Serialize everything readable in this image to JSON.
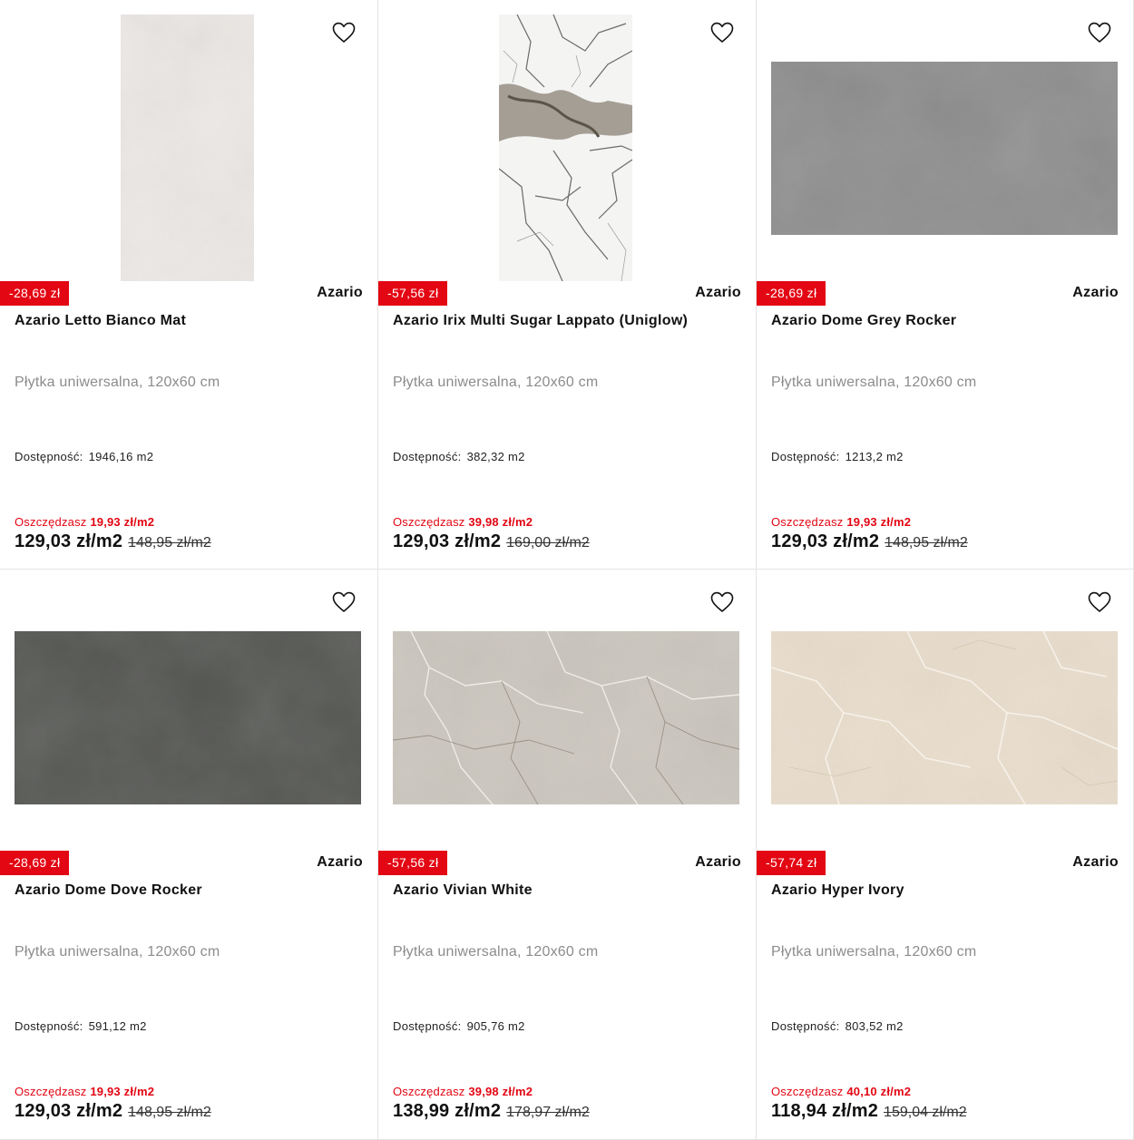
{
  "colors": {
    "accent": "#e30613",
    "text": "#111111",
    "muted": "#8c8c8c"
  },
  "products": [
    {
      "discount": "-28,69 zł",
      "brand": "Azario",
      "name": "Azario Letto Bianco Mat",
      "description": "Płytka uniwersalna, 120x60 cm",
      "availability_label": "Dostępność:",
      "availability_value": "1946,16 m2",
      "saving_label": "Oszczędzasz",
      "saving_value": "19,93 zł/m2",
      "price": "129,03 zł/m2",
      "old_price": "148,95 zł/m2",
      "favorite_icon": "heart-outline-icon"
    },
    {
      "discount": "-57,56 zł",
      "brand": "Azario",
      "name": "Azario Irix Multi Sugar Lappato (Uniglow)",
      "description": "Płytka uniwersalna, 120x60 cm",
      "availability_label": "Dostępność:",
      "availability_value": "382,32 m2",
      "saving_label": "Oszczędzasz",
      "saving_value": "39,98 zł/m2",
      "price": "129,03 zł/m2",
      "old_price": "169,00 zł/m2",
      "favorite_icon": "heart-outline-icon"
    },
    {
      "discount": "-28,69 zł",
      "brand": "Azario",
      "name": "Azario Dome Grey Rocker",
      "description": "Płytka uniwersalna, 120x60 cm",
      "availability_label": "Dostępność:",
      "availability_value": "1213,2 m2",
      "saving_label": "Oszczędzasz",
      "saving_value": "19,93 zł/m2",
      "price": "129,03 zł/m2",
      "old_price": "148,95 zł/m2",
      "favorite_icon": "heart-outline-icon"
    },
    {
      "discount": "-28,69 zł",
      "brand": "Azario",
      "name": "Azario Dome Dove Rocker",
      "description": "Płytka uniwersalna, 120x60 cm",
      "availability_label": "Dostępność:",
      "availability_value": "591,12 m2",
      "saving_label": "Oszczędzasz",
      "saving_value": "19,93 zł/m2",
      "price": "129,03 zł/m2",
      "old_price": "148,95 zł/m2",
      "favorite_icon": "heart-outline-icon"
    },
    {
      "discount": "-57,56 zł",
      "brand": "Azario",
      "name": "Azario Vivian White",
      "description": "Płytka uniwersalna, 120x60 cm",
      "availability_label": "Dostępność:",
      "availability_value": "905,76 m2",
      "saving_label": "Oszczędzasz",
      "saving_value": "39,98 zł/m2",
      "price": "138,99 zł/m2",
      "old_price": "178,97 zł/m2",
      "favorite_icon": "heart-outline-icon"
    },
    {
      "discount": "-57,74 zł",
      "brand": "Azario",
      "name": "Azario Hyper Ivory",
      "description": "Płytka uniwersalna, 120x60 cm",
      "availability_label": "Dostępność:",
      "availability_value": "803,52 m2",
      "saving_label": "Oszczędzasz",
      "saving_value": "40,10 zł/m2",
      "price": "118,94 zł/m2",
      "old_price": "159,04 zł/m2",
      "favorite_icon": "heart-outline-icon"
    }
  ]
}
